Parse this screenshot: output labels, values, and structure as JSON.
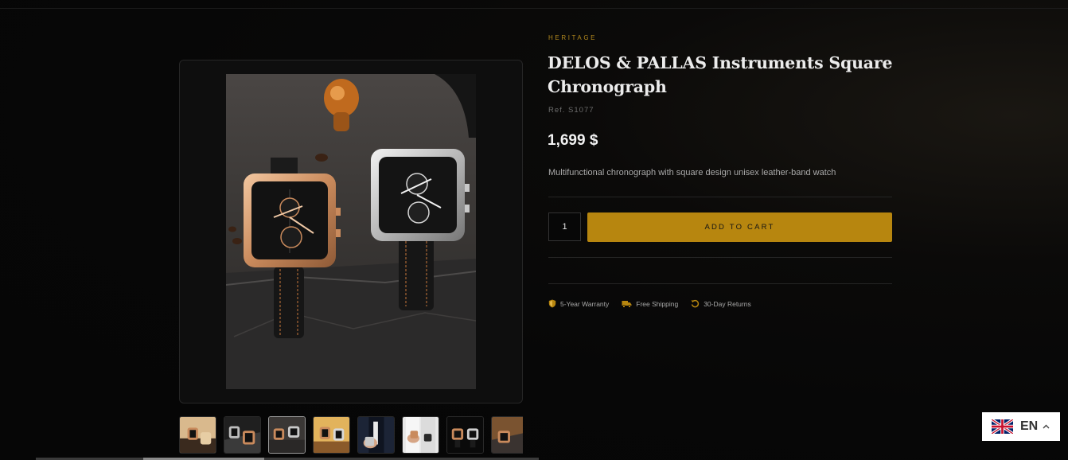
{
  "product": {
    "collection": "HERITAGE",
    "title": "DELOS & PALLAS Instruments Square Chronograph",
    "ref": "Ref. S1077",
    "price": "1,699 $",
    "description": "Multifunctional chronograph with square design unisex leather-band watch",
    "quantity": "1",
    "add_to_cart_label": "ADD TO CART"
  },
  "gallery": {
    "thumbnail_count": 8,
    "active_thumbnail": 3
  },
  "features": [
    {
      "icon": "shield-icon",
      "label": "5-Year Warranty"
    },
    {
      "icon": "truck-icon",
      "label": "Free Shipping"
    },
    {
      "icon": "return-icon",
      "label": "30-Day Returns"
    }
  ],
  "language": {
    "code": "EN",
    "flag": "uk-flag-icon"
  },
  "colors": {
    "accent": "#b7860f",
    "background": "#070707"
  }
}
